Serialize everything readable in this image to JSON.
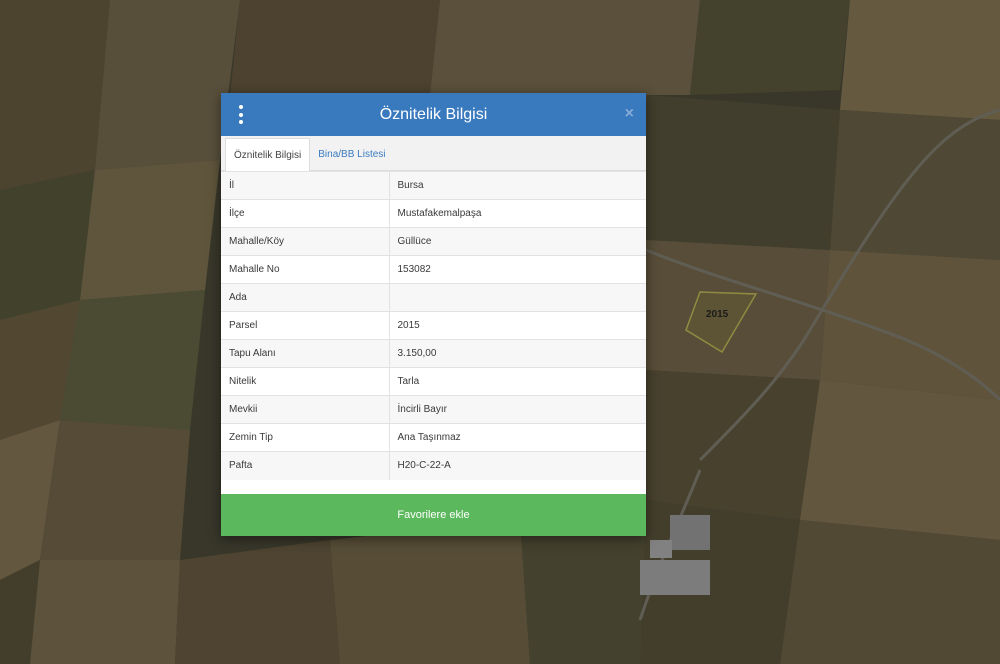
{
  "map": {
    "parcel_label": "2015"
  },
  "modal": {
    "title": "Öznitelik Bilgisi",
    "menu_icon": "kebab-menu-icon",
    "close_icon": "close-icon",
    "close_glyph": "×",
    "header_color": "#3979be",
    "tabs": [
      {
        "label": "Öznitelik Bilgisi",
        "active": true
      },
      {
        "label": "Bina/BB Listesi",
        "active": false
      }
    ],
    "rows": [
      {
        "key": "İl",
        "value": "Bursa"
      },
      {
        "key": "İlçe",
        "value": "Mustafakemalpaşa"
      },
      {
        "key": "Mahalle/Köy",
        "value": "Güllüce"
      },
      {
        "key": "Mahalle No",
        "value": "153082"
      },
      {
        "key": "Ada",
        "value": ""
      },
      {
        "key": "Parsel",
        "value": "2015"
      },
      {
        "key": "Tapu Alanı",
        "value": "3.150,00"
      },
      {
        "key": "Nitelik",
        "value": "Tarla"
      },
      {
        "key": "Mevkii",
        "value": "İncirli Bayır"
      },
      {
        "key": "Zemin Tip",
        "value": "Ana Taşınmaz"
      },
      {
        "key": "Pafta",
        "value": "H20-C-22-A"
      }
    ],
    "favorite_button": "Favorilere ekle",
    "favorite_color": "#5cb85c"
  }
}
